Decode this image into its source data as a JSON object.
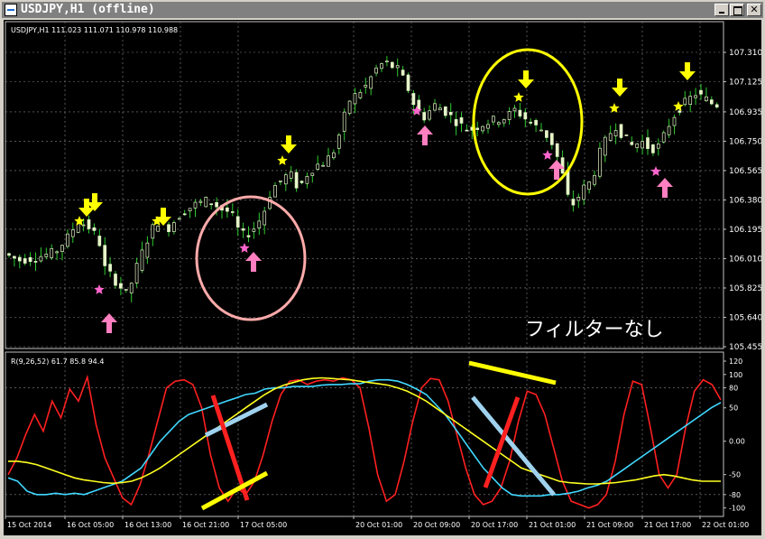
{
  "window": {
    "title": "USDJPY,H1 (offline)",
    "buttons": [
      "minimize",
      "maximize",
      "close"
    ]
  },
  "chart_data": [
    {
      "type": "candlestick",
      "symbol_header": "USDJPY,H1",
      "ohlc_header": "111.023 111.071 110.978 110.988",
      "y_ticks": [
        "107.310",
        "107.125",
        "106.935",
        "106.750",
        "106.565",
        "106.380",
        "106.195",
        "106.010",
        "105.825",
        "105.640",
        "105.455"
      ],
      "ylim": [
        105.455,
        107.31
      ],
      "colors": {
        "background": "#000000",
        "bull": "#e6f5c8",
        "bear": "#e6f5c8",
        "wick": "#2fcb2f",
        "grid": "#8a8a8a"
      },
      "overlay_text": "フィルターなし",
      "annotations": {
        "sell_arrows": 8,
        "buy_arrows": 6,
        "yellow_star_color": "#ffff00",
        "pink_star_color": "#ff66cc",
        "circles": [
          {
            "color": "#ffaaaa"
          },
          {
            "color": "#ffff00"
          }
        ]
      }
    },
    {
      "type": "line",
      "header": "R(9,26,52) 61.7 85.8 94.4",
      "y_ticks": [
        "120",
        "100",
        "80",
        "50",
        "0.00",
        "-50",
        "-80",
        "-100"
      ],
      "ylim": [
        -110,
        120
      ],
      "x_ticks": [
        "15 Oct 2014",
        "16 Oct 05:00",
        "16 Oct 13:00",
        "16 Oct 21:00",
        "17 Oct 05:00",
        "20 Oct 01:00",
        "20 Oct 09:00",
        "20 Oct 17:00",
        "21 Oct 01:00",
        "21 Oct 09:00",
        "21 Oct 17:00",
        "22 Oct 01:00"
      ],
      "series": [
        {
          "color": "#ff2020",
          "values": [
            -50,
            -25,
            10,
            40,
            15,
            60,
            35,
            78,
            60,
            96,
            25,
            -25,
            -55,
            -85,
            -95,
            -65,
            -20,
            30,
            80,
            90,
            92,
            85,
            50,
            -20,
            -70,
            -90,
            -70,
            -80,
            -60,
            -20,
            30,
            70,
            90,
            92,
            85,
            90,
            92,
            90,
            95,
            92,
            80,
            20,
            -50,
            -90,
            -80,
            -30,
            30,
            80,
            94,
            92,
            60,
            10,
            -40,
            -80,
            -95,
            -90,
            -70,
            -30,
            30,
            75,
            70,
            40,
            -10,
            -60,
            -90,
            -95,
            -100,
            -95,
            -80,
            -30,
            40,
            90,
            85,
            20,
            -50,
            -70,
            -50,
            20,
            75,
            92,
            85,
            62
          ]
        },
        {
          "color": "#40d8ff",
          "values": [
            -55,
            -60,
            -75,
            -80,
            -80,
            -78,
            -80,
            -78,
            -80,
            -75,
            -70,
            -65,
            -60,
            -50,
            -40,
            -20,
            0,
            15,
            30,
            40,
            45,
            50,
            55,
            60,
            65,
            70,
            72,
            78,
            80,
            80,
            82,
            82,
            82,
            84,
            85,
            85,
            86,
            86,
            90,
            92,
            92,
            90,
            85,
            78,
            70,
            55,
            40,
            20,
            0,
            -20,
            -40,
            -55,
            -70,
            -80,
            -82,
            -82,
            -82,
            -80,
            -80,
            -78,
            -75,
            -70,
            -66,
            -60,
            -50,
            -40,
            -30,
            -20,
            -10,
            0,
            10,
            20,
            30,
            40,
            50,
            58
          ]
        },
        {
          "color": "#ffff20",
          "values": [
            -30,
            -30,
            -32,
            -35,
            -40,
            -45,
            -50,
            -55,
            -58,
            -60,
            -62,
            -63,
            -62,
            -60,
            -55,
            -48,
            -40,
            -30,
            -20,
            -10,
            0,
            10,
            20,
            30,
            40,
            50,
            60,
            70,
            78,
            84,
            88,
            92,
            94,
            95,
            94,
            93,
            92,
            90,
            88,
            86,
            84,
            80,
            75,
            68,
            60,
            50,
            40,
            30,
            20,
            10,
            0,
            -10,
            -20,
            -30,
            -40,
            -45,
            -50,
            -55,
            -60,
            -62,
            -63,
            -64,
            -64,
            -63,
            -62,
            -60,
            -58,
            -55,
            -52,
            -50,
            -52,
            -55,
            -58,
            -60,
            -60,
            -60
          ]
        }
      ]
    }
  ]
}
